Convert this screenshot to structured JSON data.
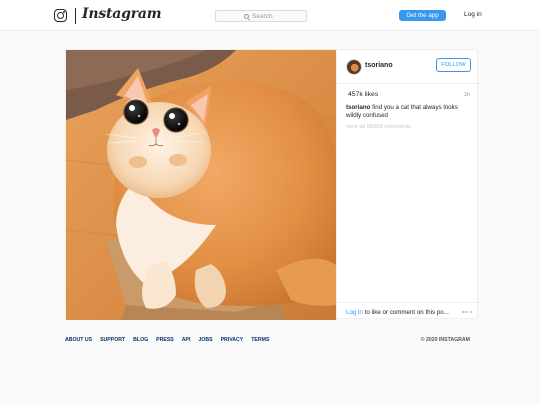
{
  "header": {
    "wordmark": "Instagram",
    "search_placeholder": "Search",
    "get_app_label": "Get the app",
    "login_label": "Log in"
  },
  "post": {
    "image_alt": "cat in a box",
    "username": "tsoriano",
    "follow_label": "FOLLOW",
    "likes": "457k likes",
    "time_ago": "1h",
    "caption_user": "tsoriano",
    "caption_text": "find you a cat that always looks wildly confused",
    "view_comments": "view all 99365 comments",
    "login_link": "Log in",
    "comment_prompt": "to like or comment on this po..."
  },
  "footer": {
    "links": [
      "ABOUT US",
      "SUPPORT",
      "BLOG",
      "PRESS",
      "API",
      "JOBS",
      "PRIVACY",
      "TERMS"
    ],
    "copyright": "© 2020 INSTAGRAM"
  },
  "colors": {
    "accent": "#3897f0",
    "footer_link": "#003569",
    "background": "#fafafa"
  },
  "icons": [
    "instagram-glyph-icon",
    "search-icon",
    "more-options-icon"
  ]
}
